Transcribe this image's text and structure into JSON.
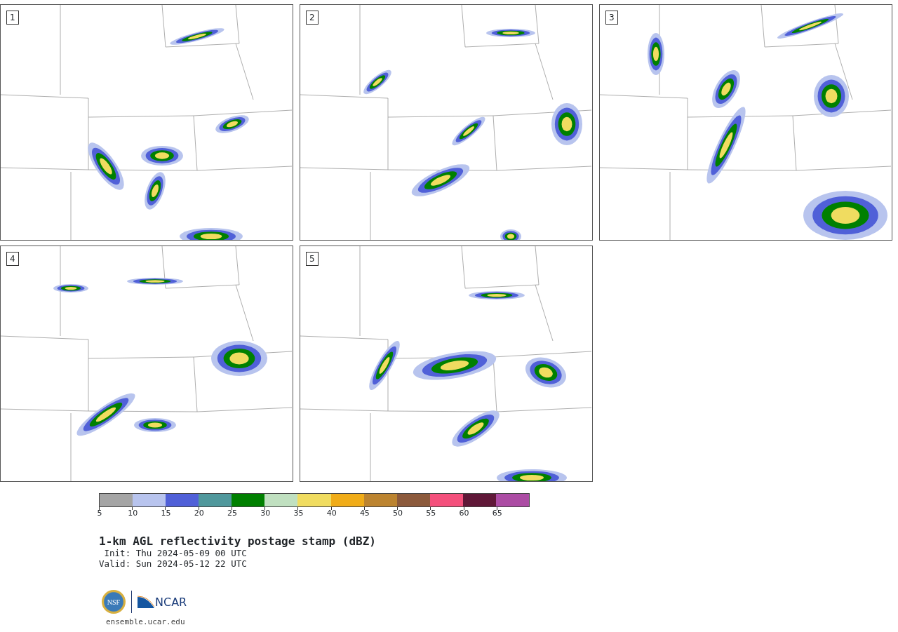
{
  "panels": [
    {
      "label": "1"
    },
    {
      "label": "2"
    },
    {
      "label": "3"
    },
    {
      "label": "4"
    },
    {
      "label": "5"
    }
  ],
  "colorbar": {
    "segments": [
      {
        "color": "#a5a5a5"
      },
      {
        "color": "#b8c4ee"
      },
      {
        "color": "#5060d8"
      },
      {
        "color": "#50989c"
      },
      {
        "color": "#008000"
      },
      {
        "color": "#c0e0c0"
      },
      {
        "color": "#f0dc60"
      },
      {
        "color": "#f0ac18"
      },
      {
        "color": "#bc8430"
      },
      {
        "color": "#8c5a3c"
      },
      {
        "color": "#f4507c"
      },
      {
        "color": "#601838"
      },
      {
        "color": "#ac4ca4"
      }
    ],
    "ticks": [
      "5",
      "10",
      "15",
      "20",
      "25",
      "30",
      "35",
      "40",
      "45",
      "50",
      "55",
      "60",
      "65"
    ]
  },
  "title": "1-km AGL reflectivity postage stamp (dBZ)",
  "init": " Init: Thu 2024-05-09 00 UTC",
  "valid": "Valid: Sun 2024-05-12 22 UTC",
  "logos": {
    "nsf": "NSF",
    "ncar": "NCAR"
  },
  "website": "ensemble.ucar.edu"
}
